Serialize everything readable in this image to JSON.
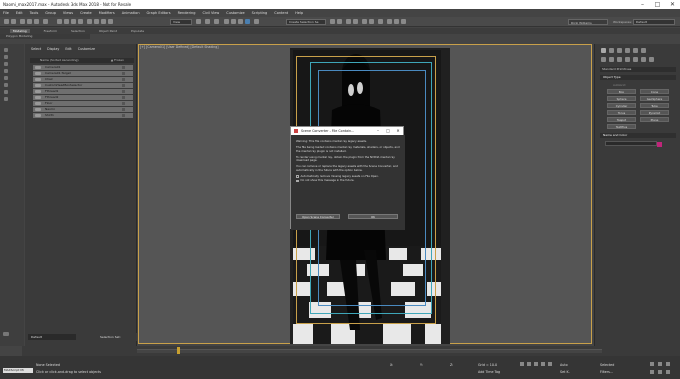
{
  "window": {
    "title": "Naomi_max2017.max - Autodesk 3ds Max 2018 - Not for Resale",
    "controls": [
      "–",
      "□",
      "✕"
    ]
  },
  "menu": [
    "File",
    "Edit",
    "Tools",
    "Group",
    "Views",
    "Create",
    "Modifiers",
    "Animation",
    "Graph Editors",
    "Rendering",
    "Civil View",
    "Customize",
    "Scripting",
    "Content",
    "Help"
  ],
  "toolbar": {
    "view_dropdown": "View",
    "selection_set": "Create Selection Se",
    "user": "Ricki Williams",
    "workspaces_label": "Workspaces:",
    "workspace": "Default"
  },
  "ribbon": {
    "tabs": [
      "Modeling",
      "Freeform",
      "Selection",
      "Object Paint",
      "Populate"
    ],
    "active": "Modeling",
    "sub": "Polygon Modeling"
  },
  "scene_explorer": {
    "tabs": [
      "Select",
      "Display",
      "Edit",
      "Customize"
    ],
    "header": "Name (Sorted Ascending)",
    "frozen_header": "▲ Frozen",
    "items": [
      "Camera01",
      "Camera01.Target",
      "Chair",
      "CustomHeadBoxSelector",
      "Fthread1",
      "Fthread2",
      "Floor",
      "Naomi",
      "Shirt1"
    ]
  },
  "layer": {
    "name": "Default",
    "selection_set_label": "Selection Set:"
  },
  "viewport": {
    "label": "[+] [Camera01] [User Defined] [Default Shading]"
  },
  "command_panel": {
    "dropdown": "Standard Primitives",
    "object_type_label": "Object Type",
    "autogrid": "AutoGrid",
    "buttons": [
      "Box",
      "Cone",
      "Sphere",
      "GeoSphere",
      "Cylinder",
      "Tube",
      "Torus",
      "Pyramid",
      "Teapot",
      "Plane",
      "TextPlus"
    ],
    "name_color_label": "Name and Color",
    "swatch_color": "#c0257a"
  },
  "timeline": {
    "position": "0 / 100"
  },
  "status": {
    "selection": "None Selected",
    "prompt": "Click or click-and-drag to select objects",
    "listener": "MAXScript Mi",
    "x_label": "X:",
    "y_label": "Y:",
    "z_label": "Z:",
    "grid": "Grid = 10.0",
    "add_time_tag": "Add Time Tag",
    "auto": "Auto",
    "selected": "Selected",
    "set_k": "Set K.",
    "filters": "Filters..."
  },
  "dialog": {
    "title": "Scene Converter - File Contain...",
    "warning": "Warning: This file contains mental ray legacy assets.",
    "p1": "The file being loaded contains mental ray materials, shaders, or objects, and the mental ray plugin is not installed.",
    "p2": "To render using mental ray, obtain the plugin from the NVIDIA mental ray download page.",
    "p3": "You can remove or replace the legacy assets with the Scene Converter, and automatically in the future with the option below.",
    "cb1": "Automatically remove missing legacy assets on File Open.",
    "cb2": "Do not show this message in the future.",
    "open_button": "Open Scene Converter",
    "ok_button": "OK"
  }
}
